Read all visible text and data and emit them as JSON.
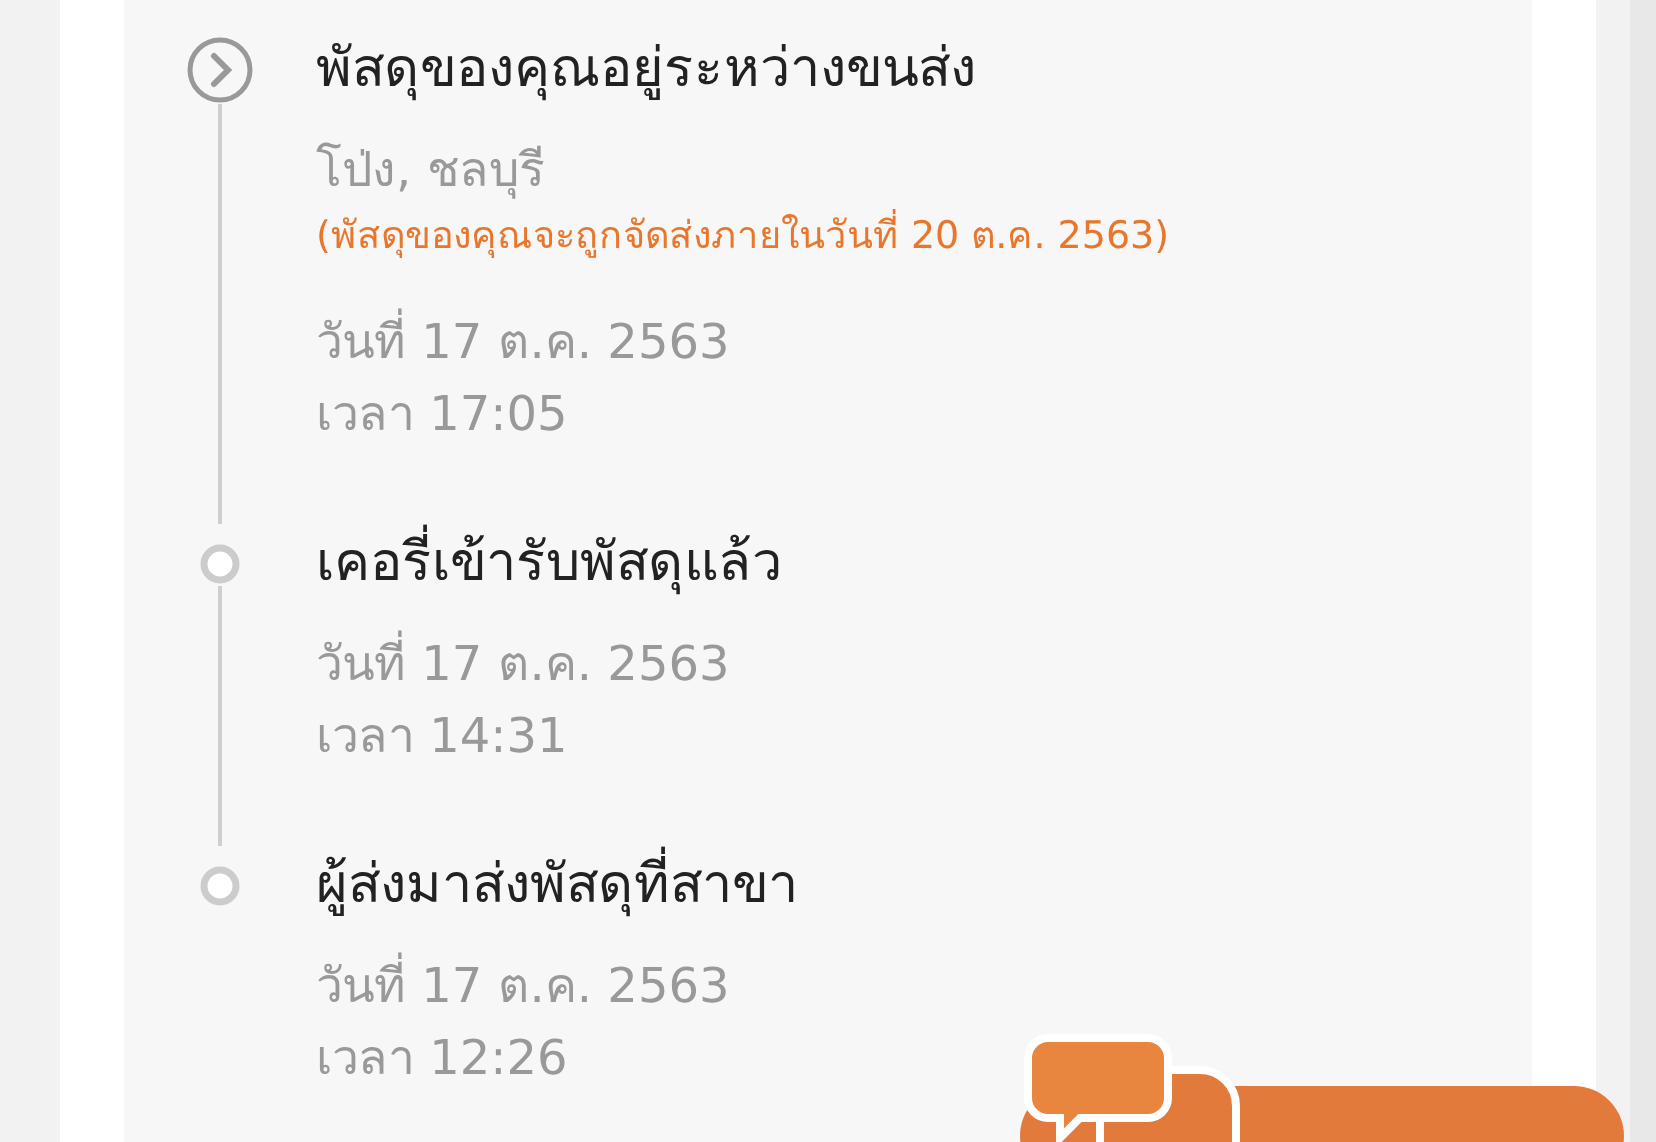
{
  "timeline": [
    {
      "kind": "current",
      "title": "พัสดุของคุณอยู่ระหว่างขนส่ง",
      "location": "โป่ง, ชลบุรี",
      "note": "(พัสดุของคุณจะถูกจัดส่งภายในวันที่ 20 ต.ค. 2563)",
      "date": "วันที่ 17 ต.ค. 2563",
      "time": "เวลา 17:05"
    },
    {
      "kind": "done",
      "title": "เคอรี่เข้ารับพัสดุแล้ว",
      "date": "วันที่ 17 ต.ค. 2563",
      "time": "เวลา 14:31"
    },
    {
      "kind": "done",
      "title": "ผู้ส่งมาส่งพัสดุที่สาขา",
      "date": "วันที่ 17 ต.ค. 2563",
      "time": "เวลา 12:26"
    }
  ]
}
